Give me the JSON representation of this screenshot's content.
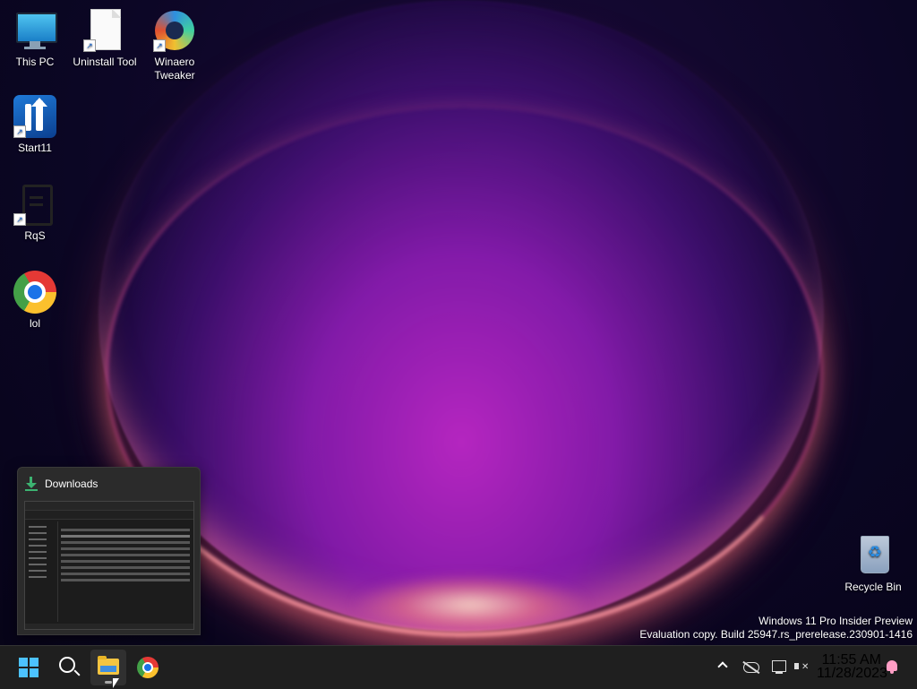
{
  "desktop": {
    "icons": [
      {
        "label": "This PC",
        "icon": "monitor-icon"
      },
      {
        "label": "Uninstall Tool",
        "icon": "document-icon"
      },
      {
        "label": "Winaero Tweaker",
        "icon": "winaero-tweaker-icon"
      },
      {
        "label": "Start11",
        "icon": "start11-icon"
      },
      {
        "label": "RqS",
        "icon": "rqs-icon"
      },
      {
        "label": "lol",
        "icon": "chrome-icon"
      },
      {
        "label": "Recycle Bin",
        "icon": "recycle-bin-icon"
      }
    ],
    "watermark": {
      "line1": "Windows 11 Pro Insider Preview",
      "line2": "Evaluation copy. Build 25947.rs_prerelease.230901-1416"
    }
  },
  "thumbnail_preview": {
    "title": "Downloads",
    "icon": "download-arrow-icon",
    "accent": "#3cb371"
  },
  "taskbar": {
    "buttons": [
      {
        "name": "start-button",
        "icon": "windows-logo-icon"
      },
      {
        "name": "search-button",
        "icon": "search-icon"
      },
      {
        "name": "file-explorer-button",
        "icon": "folder-icon",
        "active": true
      },
      {
        "name": "chrome-button",
        "icon": "chrome-icon"
      }
    ],
    "tray": {
      "time": "11:55 AM",
      "date": "11/28/2023"
    },
    "colors": {
      "background": "#1f1f1f",
      "start_accent": "#4cc2ff",
      "notification_accent": "#ff9ec5"
    }
  }
}
